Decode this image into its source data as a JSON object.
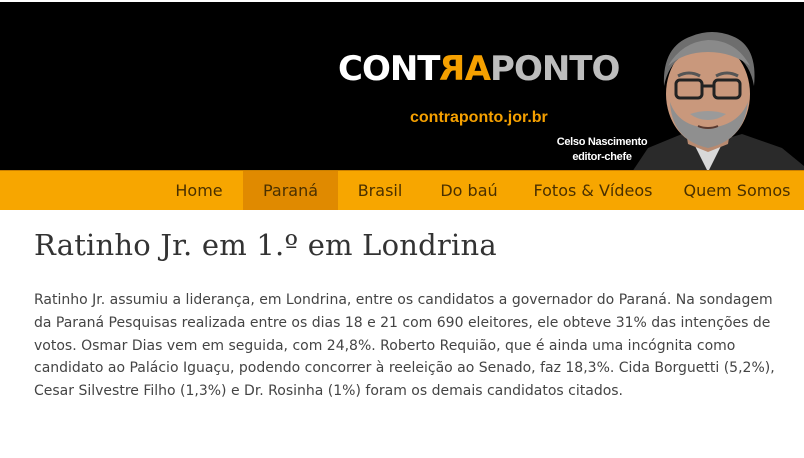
{
  "header": {
    "logo": {
      "part1": "CONT",
      "part2": "R",
      "part3": "A",
      "part4": "PONTO"
    },
    "site_url": "contraponto.jor.br",
    "caption_name": "Celso Nascimento",
    "caption_role": "editor-chefe"
  },
  "nav": {
    "items": [
      {
        "label": "Home"
      },
      {
        "label": "Paraná"
      },
      {
        "label": "Brasil"
      },
      {
        "label": "Do baú"
      },
      {
        "label": "Fotos & Vídeos"
      },
      {
        "label": "Quem Somos"
      }
    ],
    "active": "Paraná"
  },
  "article": {
    "title": "Ratinho Jr. em 1.º em Londrina",
    "body": "Ratinho Jr. assumiu a liderança, em Londrina, entre os candidatos a governador do Paraná. Na sondagem da Paraná Pesquisas realizada entre os dias 18 e 21 com 690 eleitores, ele obteve 31% das intenções de votos. Osmar Dias vem em seguida, com 24,8%. Roberto Requião, que é ainda uma incógnita como candidato ao Palácio Iguaçu, podendo concorrer à reeleição ao Senado, faz 18,3%. Cida Borguetti (5,2%), Cesar Silvestre Filho (1,3%) e Dr. Rosinha (1%) foram os demais candidatos citados."
  },
  "colors": {
    "header_bg": "#000000",
    "accent": "#f5a000",
    "nav_bg": "#f7a600",
    "nav_active": "#e08a00"
  }
}
